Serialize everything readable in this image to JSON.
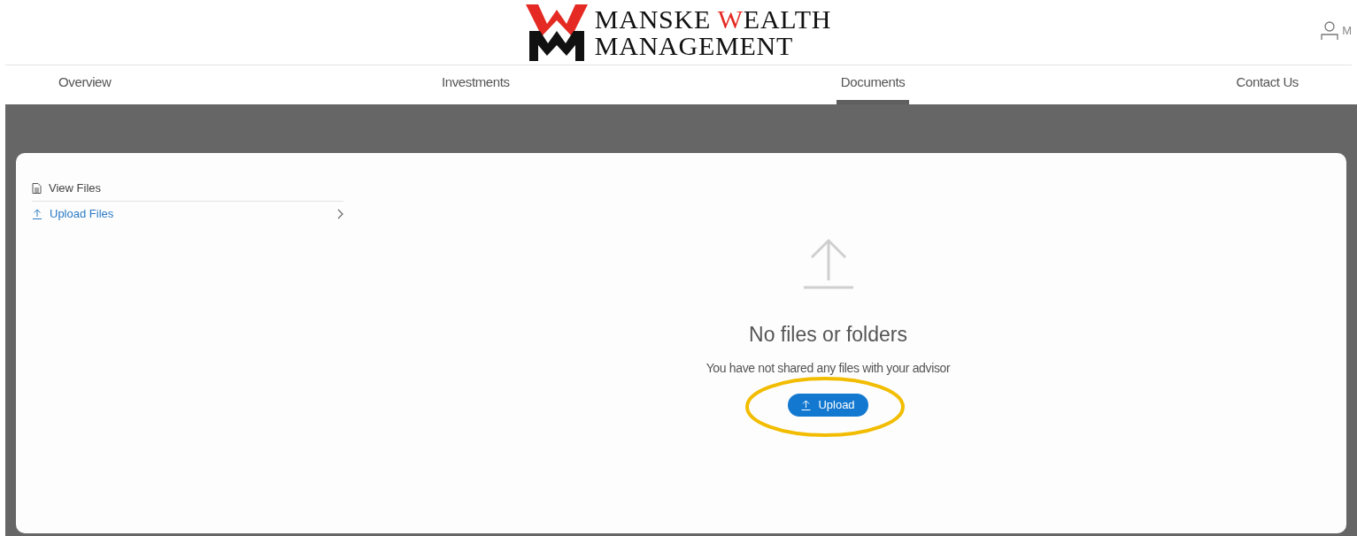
{
  "brand": {
    "line1": [
      {
        "text": "MANSKE ",
        "accent": false
      },
      {
        "text": "W",
        "accent": true
      },
      {
        "text": "EALTH",
        "accent": false
      }
    ],
    "line2": "MANAGEMENT"
  },
  "user": {
    "name": "M"
  },
  "tabs": [
    {
      "label": "Overview",
      "selected": false
    },
    {
      "label": "Investments",
      "selected": false
    },
    {
      "label": "Documents",
      "selected": true
    },
    {
      "label": "Contact Us",
      "selected": false
    }
  ],
  "sidebar": {
    "items": [
      {
        "label": "View Files",
        "kind": "file",
        "selected": false
      },
      {
        "label": "Upload Files",
        "kind": "upload",
        "selected": true
      }
    ]
  },
  "empty_state": {
    "title": "No files or folders",
    "message": "You have not shared any files with your advisor",
    "button": "Upload"
  },
  "annotation": {
    "kind": "ellipse",
    "color": "#f2bd00"
  }
}
